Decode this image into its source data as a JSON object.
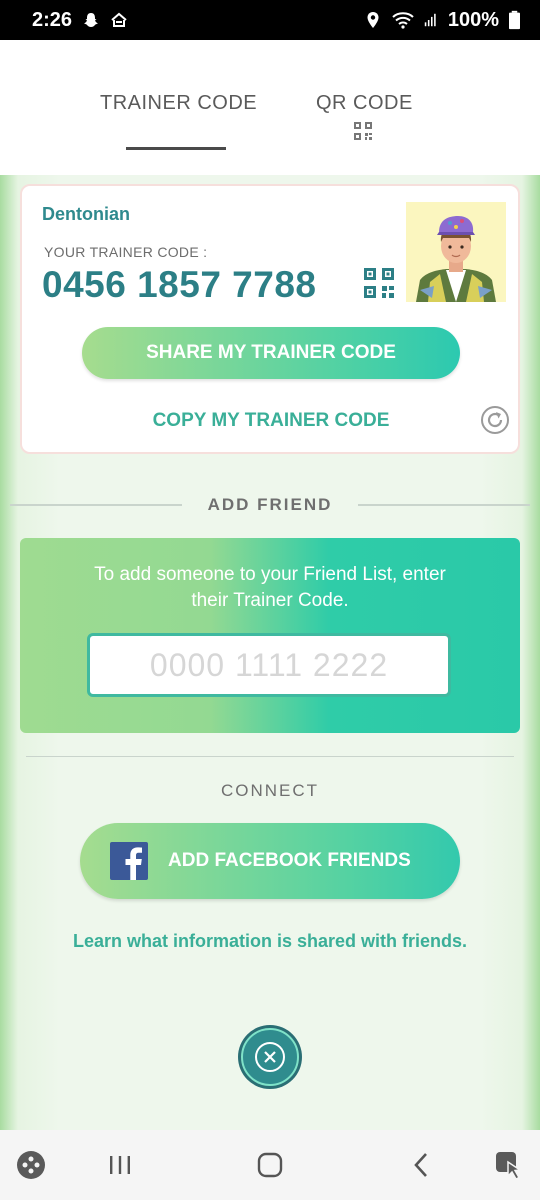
{
  "status_bar": {
    "time": "2:26",
    "battery": "100%"
  },
  "tabs": {
    "trainer_code": "TRAINER CODE",
    "qr_code": "QR CODE",
    "active": "trainer_code"
  },
  "trainer_card": {
    "username": "Dentonian",
    "code_label": "YOUR TRAINER CODE :",
    "code": "0456 1857 7788",
    "share_button": "SHARE MY TRAINER CODE",
    "copy_button": "COPY MY TRAINER CODE"
  },
  "add_friend": {
    "title": "ADD FRIEND",
    "instruction": "To add someone to your Friend List, enter their Trainer Code.",
    "input_placeholder": "0000 1111 2222",
    "input_value": ""
  },
  "connect": {
    "title": "CONNECT",
    "facebook_button": "ADD FACEBOOK FRIENDS",
    "learn_link": "Learn what information is shared with friends."
  },
  "icons": {
    "status_left": [
      "snapchat-icon",
      "home-icon"
    ],
    "status_right": [
      "location-icon",
      "wifi-icon",
      "signal-icon",
      "battery-icon"
    ],
    "nav": [
      "game-launcher-icon",
      "recents-icon",
      "home-button-icon",
      "back-icon",
      "screenshot-tool-icon"
    ]
  },
  "colors": {
    "accent_teal": "#2c7f86",
    "accent_green": "#3aaf98",
    "facebook_blue": "#3b5998"
  }
}
